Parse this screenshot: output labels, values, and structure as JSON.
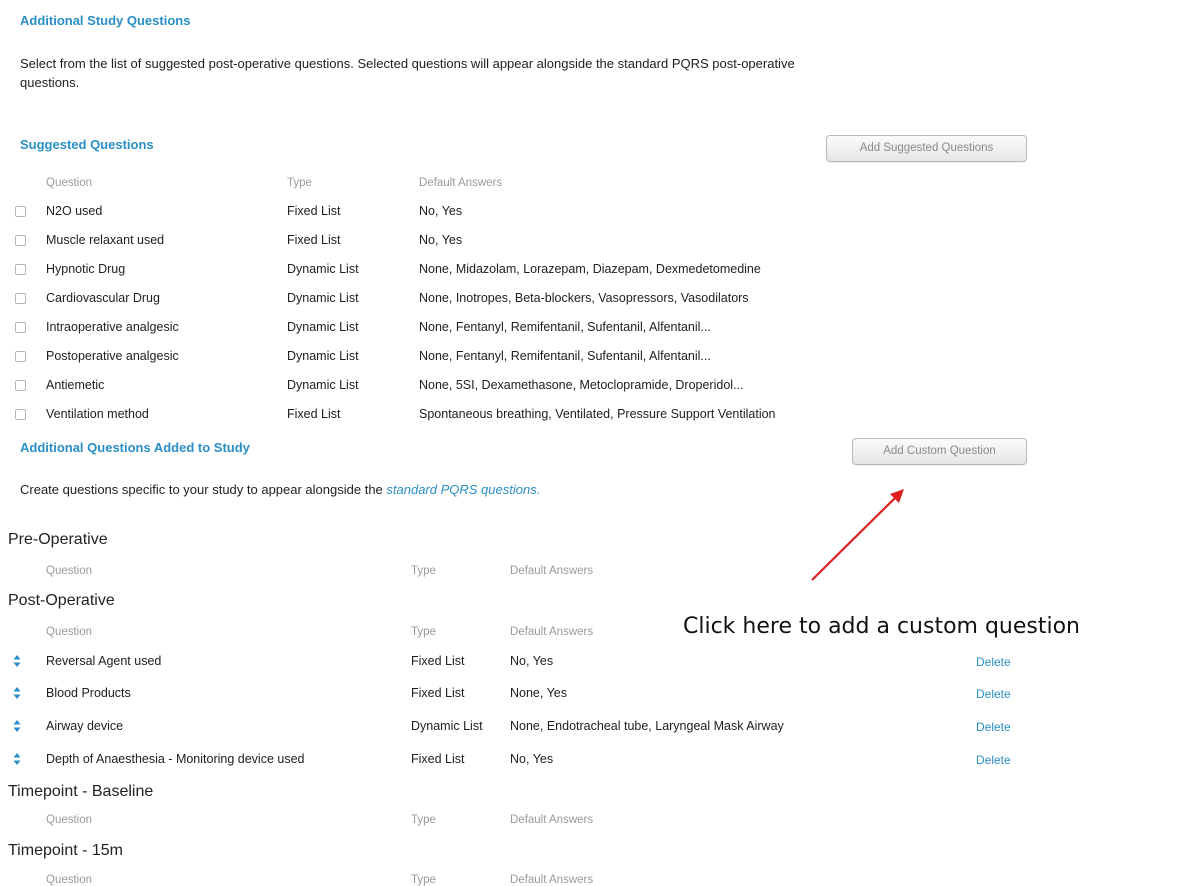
{
  "additional_study": {
    "title": "Additional Study Questions",
    "description_line1": "Select from the list of suggested post-operative questions. Selected questions will appear alongside the standard PQRS post-operative",
    "description_line2": "questions."
  },
  "suggested": {
    "title": "Suggested Questions",
    "add_button_label": "Add Suggested Questions",
    "headers": {
      "question": "Question",
      "type": "Type",
      "answers": "Default Answers"
    },
    "rows": [
      {
        "question": "N2O used",
        "type": "Fixed List",
        "answers": "No, Yes"
      },
      {
        "question": "Muscle relaxant used",
        "type": "Fixed List",
        "answers": "No, Yes"
      },
      {
        "question": "Hypnotic Drug",
        "type": "Dynamic List",
        "answers": "None, Midazolam, Lorazepam, Diazepam, Dexmedetomedine"
      },
      {
        "question": "Cardiovascular Drug",
        "type": "Dynamic List",
        "answers": "None, Inotropes, Beta-blockers, Vasopressors, Vasodilators"
      },
      {
        "question": "Intraoperative analgesic",
        "type": "Dynamic List",
        "answers": "None, Fentanyl, Remifentanil, Sufentanil, Alfentanil..."
      },
      {
        "question": "Postoperative analgesic",
        "type": "Dynamic List",
        "answers": "None, Fentanyl, Remifentanil, Sufentanil, Alfentanil..."
      },
      {
        "question": "Antiemetic",
        "type": "Dynamic List",
        "answers": "None, 5SI, Dexamethasone, Metoclopramide, Droperidol..."
      },
      {
        "question": "Ventilation method",
        "type": "Fixed List",
        "answers": "Spontaneous breathing, Ventilated, Pressure Support Ventilation"
      }
    ]
  },
  "added": {
    "title": "Additional Questions Added to Study",
    "add_button_label": "Add Custom Question",
    "description_prefix": "Create questions specific to your study to appear alongside the ",
    "description_link": "standard PQRS questions.",
    "headers": {
      "question": "Question",
      "type": "Type",
      "answers": "Default Answers"
    },
    "delete_label": "Delete",
    "groups": [
      {
        "title": "Pre-Operative",
        "rows": []
      },
      {
        "title": "Post-Operative",
        "rows": [
          {
            "question": "Reversal Agent used",
            "type": "Fixed List",
            "answers": "No, Yes"
          },
          {
            "question": "Blood Products",
            "type": "Fixed List",
            "answers": "None, Yes"
          },
          {
            "question": "Airway device",
            "type": "Dynamic List",
            "answers": "None, Endotracheal tube, Laryngeal Mask Airway"
          },
          {
            "question": "Depth of Anaesthesia - Monitoring device used",
            "type": "Fixed List",
            "answers": "No, Yes"
          }
        ]
      },
      {
        "title": "Timepoint - Baseline",
        "rows": []
      },
      {
        "title": "Timepoint - 15m",
        "rows": []
      }
    ]
  },
  "annotation": {
    "text": "Click here to add a custom question",
    "arrow_color": "#e02020"
  },
  "colors": {
    "accent": "#2a8fc7"
  }
}
